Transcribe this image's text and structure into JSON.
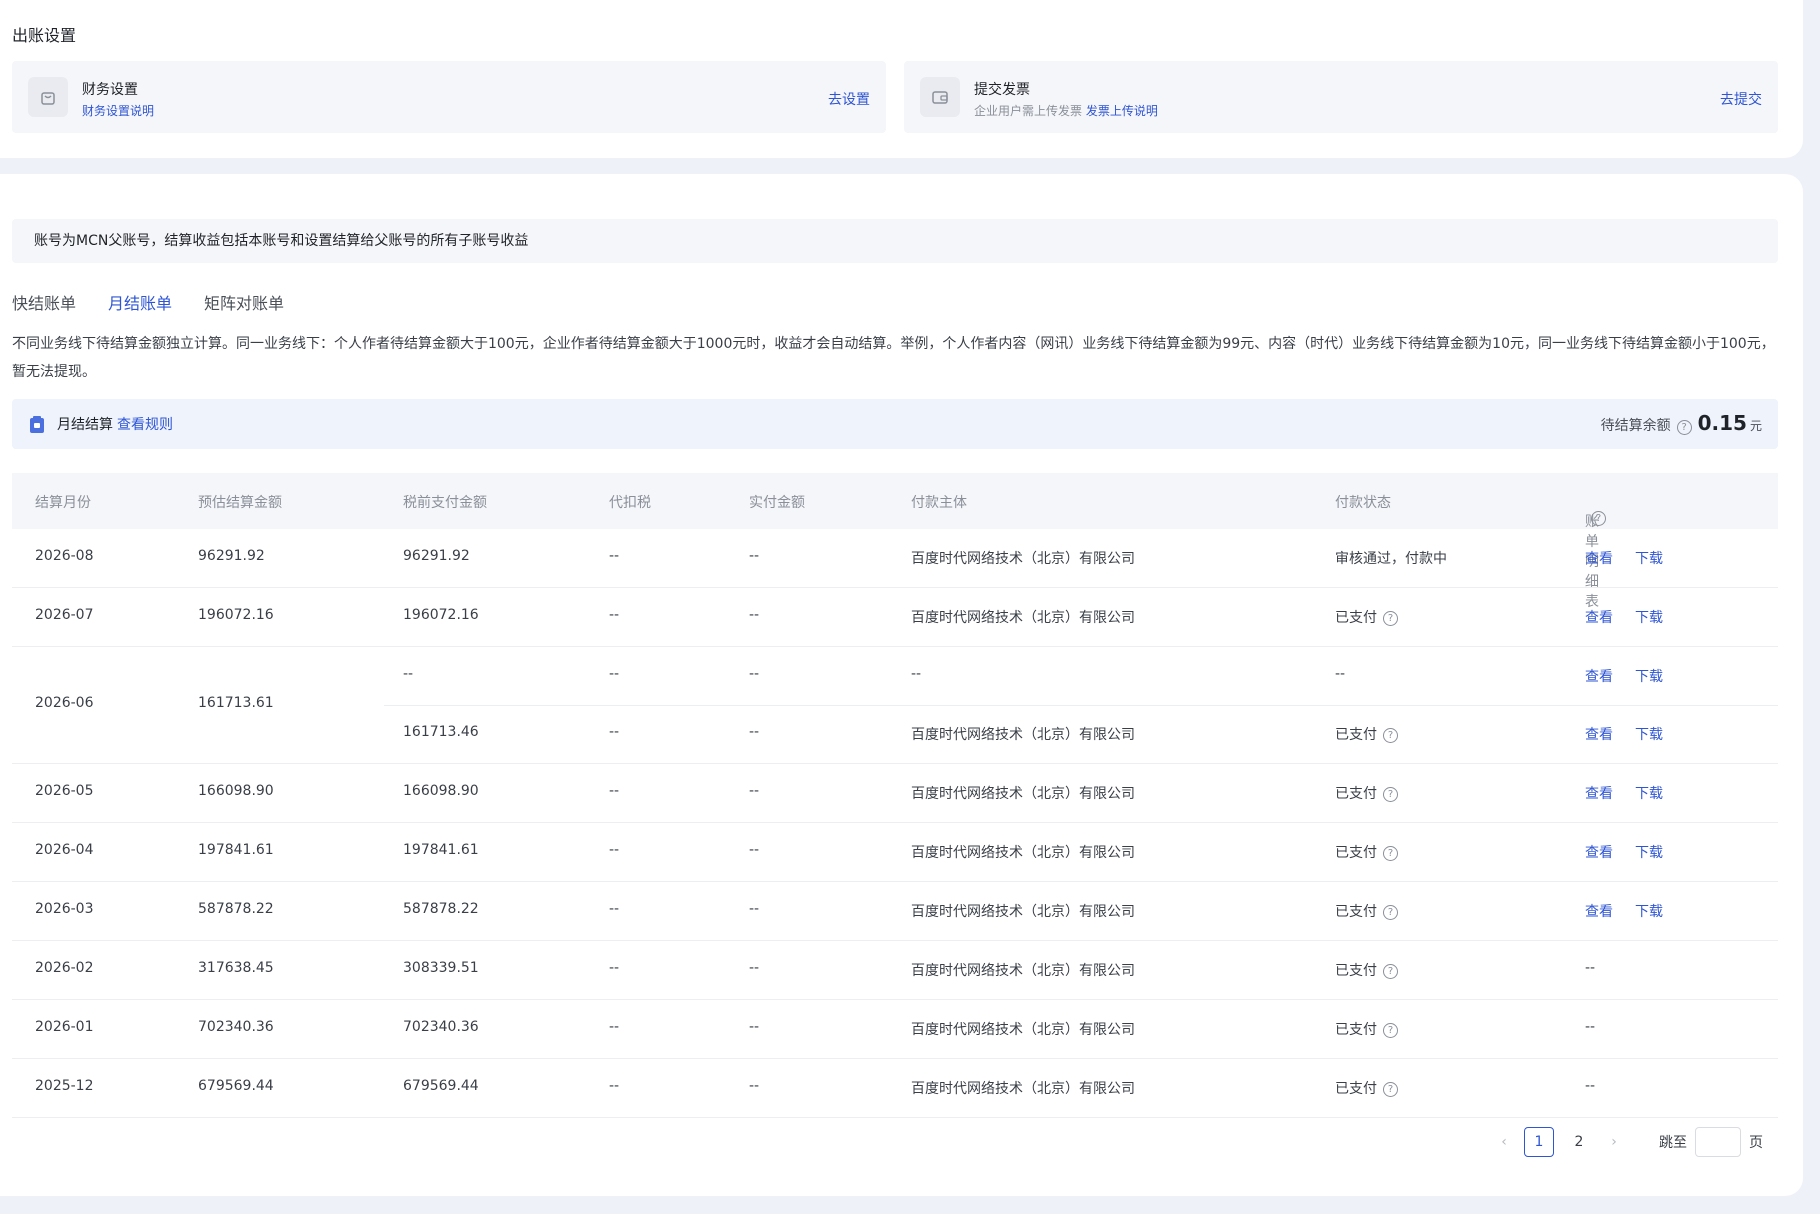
{
  "billing_settings": {
    "title": "出账设置",
    "finance": {
      "title": "财务设置",
      "sub_link": "财务设置说明",
      "action": "去设置"
    },
    "invoice": {
      "title": "提交发票",
      "sub_text": "企业用户需上传发票",
      "sub_link": "发票上传说明",
      "action": "去提交"
    }
  },
  "notice": "账号为MCN父账号，结算收益包括本账号和设置结算给父账号的所有子账号收益",
  "tabs": [
    {
      "label": "快结账单",
      "active": false
    },
    {
      "label": "月结账单",
      "active": true
    },
    {
      "label": "矩阵对账单",
      "active": false
    }
  ],
  "rule_text": "不同业务线下待结算金额独立计算。同一业务线下：个人作者待结算金额大于100元，企业作者待结算金额大于1000元时，收益才会自动结算。举例，个人作者内容（网讯）业务线下待结算金额为99元、内容（时代）业务线下待结算金额为10元，同一业务线下待结算金额小于100元，暂无法提现。",
  "summary": {
    "label": "月结结算",
    "rule_link": "查看规则",
    "pending_label": "待结算余额",
    "pending_amount": "0.15",
    "unit": "元"
  },
  "table": {
    "headers": [
      "结算月份",
      "预估结算金额",
      "税前支付金额",
      "代扣税",
      "实付金额",
      "付款主体",
      "付款状态",
      "账单明细表"
    ],
    "view_label": "查看",
    "download_label": "下载",
    "rows": [
      {
        "month": "2026-08",
        "est": "96291.92",
        "pretax": "96291.92",
        "tax": "--",
        "paid": "--",
        "payer": "百度时代网络技术（北京）有限公司",
        "status": "审核通过，付款中",
        "status_help": false,
        "detail": "links"
      },
      {
        "month": "2026-07",
        "est": "196072.16",
        "pretax": "196072.16",
        "tax": "--",
        "paid": "--",
        "payer": "百度时代网络技术（北京）有限公司",
        "status": "已支付",
        "status_help": true,
        "detail": "links"
      }
    ],
    "merged": {
      "month": "2026-06",
      "est": "161713.61",
      "subs": [
        {
          "pretax": "--",
          "tax": "--",
          "paid": "--",
          "payer": "--",
          "status": "--",
          "status_help": false
        },
        {
          "pretax": "161713.46",
          "tax": "--",
          "paid": "--",
          "payer": "百度时代网络技术（北京）有限公司",
          "status": "已支付",
          "status_help": true
        }
      ]
    },
    "rows_after": [
      {
        "month": "2026-05",
        "est": "166098.90",
        "pretax": "166098.90",
        "tax": "--",
        "paid": "--",
        "payer": "百度时代网络技术（北京）有限公司",
        "status": "已支付",
        "detail": "links"
      },
      {
        "month": "2026-04",
        "est": "197841.61",
        "pretax": "197841.61",
        "tax": "--",
        "paid": "--",
        "payer": "百度时代网络技术（北京）有限公司",
        "status": "已支付",
        "detail": "links"
      },
      {
        "month": "2026-03",
        "est": "587878.22",
        "pretax": "587878.22",
        "tax": "--",
        "paid": "--",
        "payer": "百度时代网络技术（北京）有限公司",
        "status": "已支付",
        "detail": "links"
      },
      {
        "month": "2026-02",
        "est": "317638.45",
        "pretax": "308339.51",
        "tax": "--",
        "paid": "--",
        "payer": "百度时代网络技术（北京）有限公司",
        "status": "已支付",
        "detail": "--"
      },
      {
        "month": "2026-01",
        "est": "702340.36",
        "pretax": "702340.36",
        "tax": "--",
        "paid": "--",
        "payer": "百度时代网络技术（北京）有限公司",
        "status": "已支付",
        "detail": "--"
      },
      {
        "month": "2025-12",
        "est": "679569.44",
        "pretax": "679569.44",
        "tax": "--",
        "paid": "--",
        "payer": "百度时代网络技术（北京）有限公司",
        "status": "已支付",
        "detail": "--"
      }
    ]
  },
  "pagination": {
    "pages": [
      "1",
      "2"
    ],
    "current": "1",
    "jump_label": "跳至",
    "page_suffix": "页",
    "prev": "‹",
    "next": "›"
  }
}
